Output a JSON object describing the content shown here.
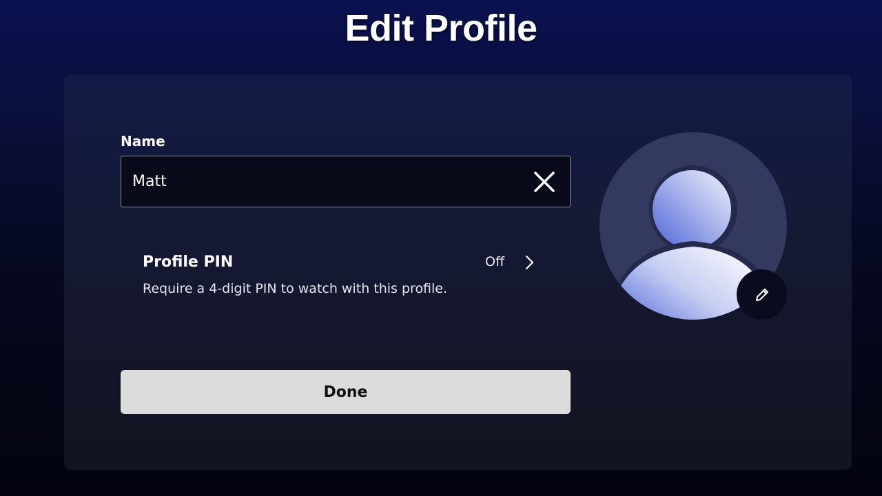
{
  "header": {
    "title": "Edit Profile"
  },
  "form": {
    "name_label": "Name",
    "name_value": "Matt",
    "clear_icon": "close-icon",
    "pin": {
      "title": "Profile PIN",
      "description": "Require a 4-digit PIN to watch with this profile.",
      "status": "Off",
      "chevron_icon": "chevron-right-icon"
    },
    "done_label": "Done"
  },
  "avatar": {
    "icon": "user-silhouette-icon",
    "edit_icon": "pencil-icon"
  },
  "colors": {
    "background_top": "#0a1150",
    "background_bottom": "#03040f",
    "card": "#151a38",
    "button": "#dcdcdc",
    "avatar_circle": "#33395f",
    "avatar_accent": "#4e63d6"
  }
}
